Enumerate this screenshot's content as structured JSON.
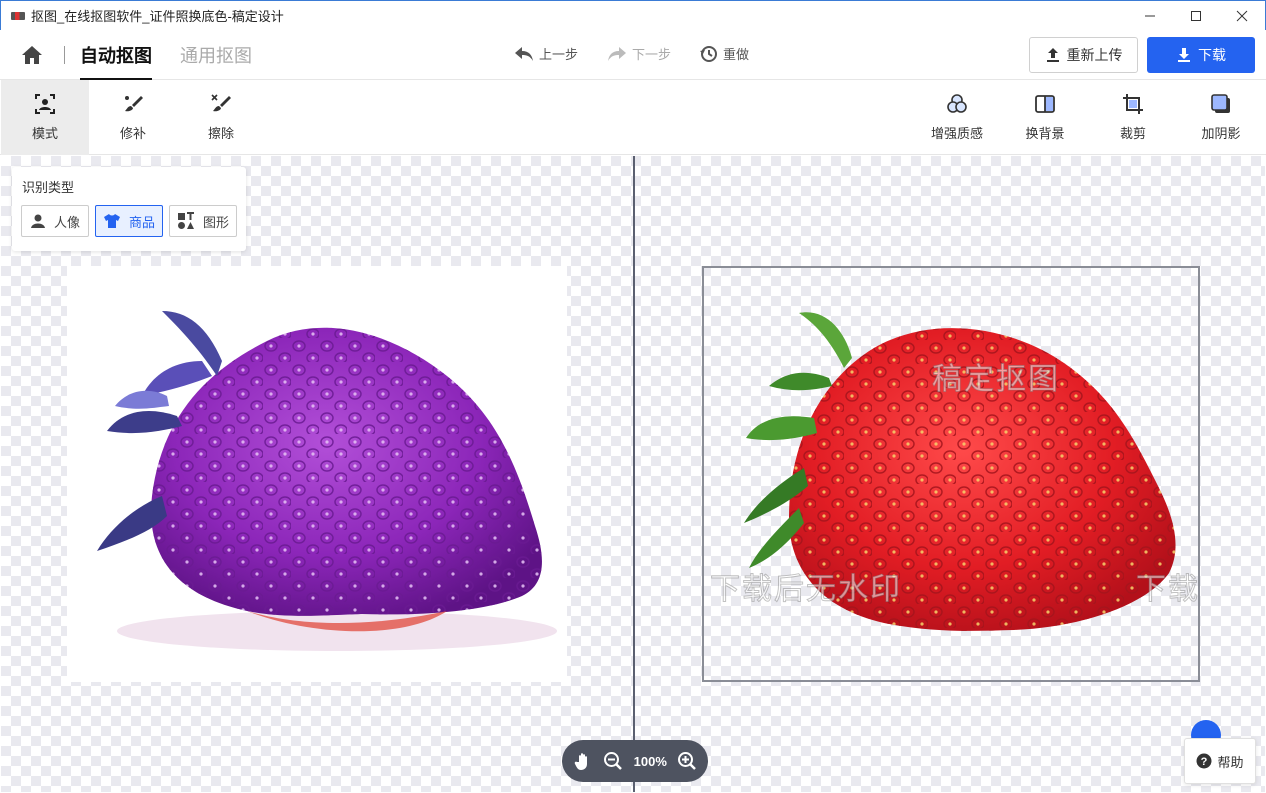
{
  "window": {
    "title": "抠图_在线抠图软件_证件照换底色-稿定设计",
    "controls": [
      "minimize-icon",
      "maximize-icon",
      "close-icon"
    ]
  },
  "header": {
    "tabs": [
      {
        "label": "自动抠图",
        "active": true
      },
      {
        "label": "通用抠图",
        "active": false
      }
    ],
    "undo_label": "上一步",
    "redo_label": "下一步",
    "reset_label": "重做",
    "upload_label": "重新上传",
    "download_label": "下载"
  },
  "toolbar": {
    "left_tools": [
      {
        "label": "模式",
        "icon": "mode-icon",
        "active": true
      },
      {
        "label": "修补",
        "icon": "repair-brush-icon",
        "active": false
      },
      {
        "label": "擦除",
        "icon": "erase-brush-icon",
        "active": false
      }
    ],
    "right_tools": [
      {
        "label": "增强质感",
        "icon": "enhance-icon"
      },
      {
        "label": "换背景",
        "icon": "background-icon"
      },
      {
        "label": "裁剪",
        "icon": "crop-icon"
      },
      {
        "label": "加阴影",
        "icon": "shadow-icon"
      }
    ]
  },
  "recognition": {
    "title": "识别类型",
    "options": [
      {
        "label": "人像",
        "icon": "person-icon",
        "active": false
      },
      {
        "label": "商品",
        "icon": "tshirt-icon",
        "active": true
      },
      {
        "label": "图形",
        "icon": "shapes-icon",
        "active": false
      }
    ]
  },
  "preview": {
    "watermark_top": "稿定抠图",
    "watermark_bottom": "下载后无水印",
    "watermark_bottom_partial": "下载"
  },
  "zoom": {
    "level": "100%"
  },
  "help": {
    "label": "帮助"
  },
  "colors": {
    "accent": "#2463f0",
    "zoom_bar": "#4e5360"
  }
}
